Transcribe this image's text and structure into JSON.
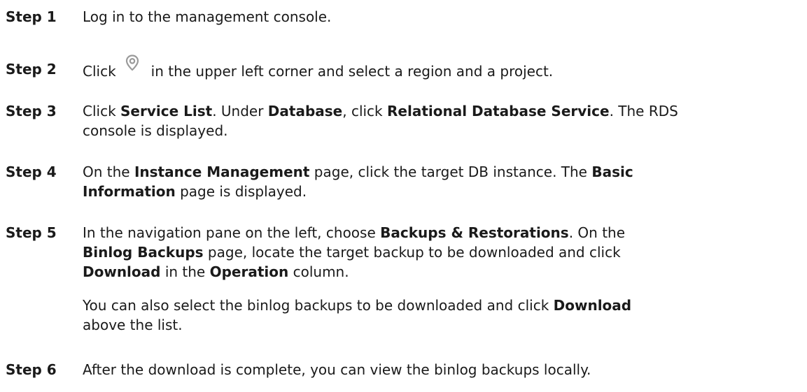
{
  "steps": [
    {
      "label": "Step 1",
      "text": "Log in to the management console."
    },
    {
      "label": "Step 2",
      "text_before_icon": "Click",
      "icon": "location-pin-icon",
      "text_after_icon": "in the upper left corner and select a region and a project."
    },
    {
      "label": "Step 3",
      "parts": {
        "a": "Click ",
        "b": "Service List",
        "c": ". Under ",
        "d": "Database",
        "e": ", click ",
        "f": "Relational Database Service",
        "g": ". The RDS",
        "h": "console is displayed."
      }
    },
    {
      "label": "Step 4",
      "parts": {
        "a": "On the ",
        "b": "Instance Management",
        "c": " page, click the target DB instance. The ",
        "d": "Basic",
        "e": "Information",
        "f": " page is displayed."
      }
    },
    {
      "label": "Step 5",
      "parts": {
        "a": "In the navigation pane on the left, choose ",
        "b": "Backups & Restorations",
        "c": ". On the",
        "d": "Binlog Backups",
        "e": " page, locate the target backup to be downloaded and click",
        "f": "Download",
        "g": " in the ",
        "h": "Operation",
        "i": " column."
      },
      "note": {
        "a": "You can also select the binlog backups to be downloaded and click ",
        "b": "Download",
        "c": "above the list."
      }
    },
    {
      "label": "Step 6",
      "text": "After the download is complete, you can view the binlog backups locally."
    }
  ],
  "colors": {
    "text": "#1a1a1a",
    "icon": "#9a9a9a"
  }
}
